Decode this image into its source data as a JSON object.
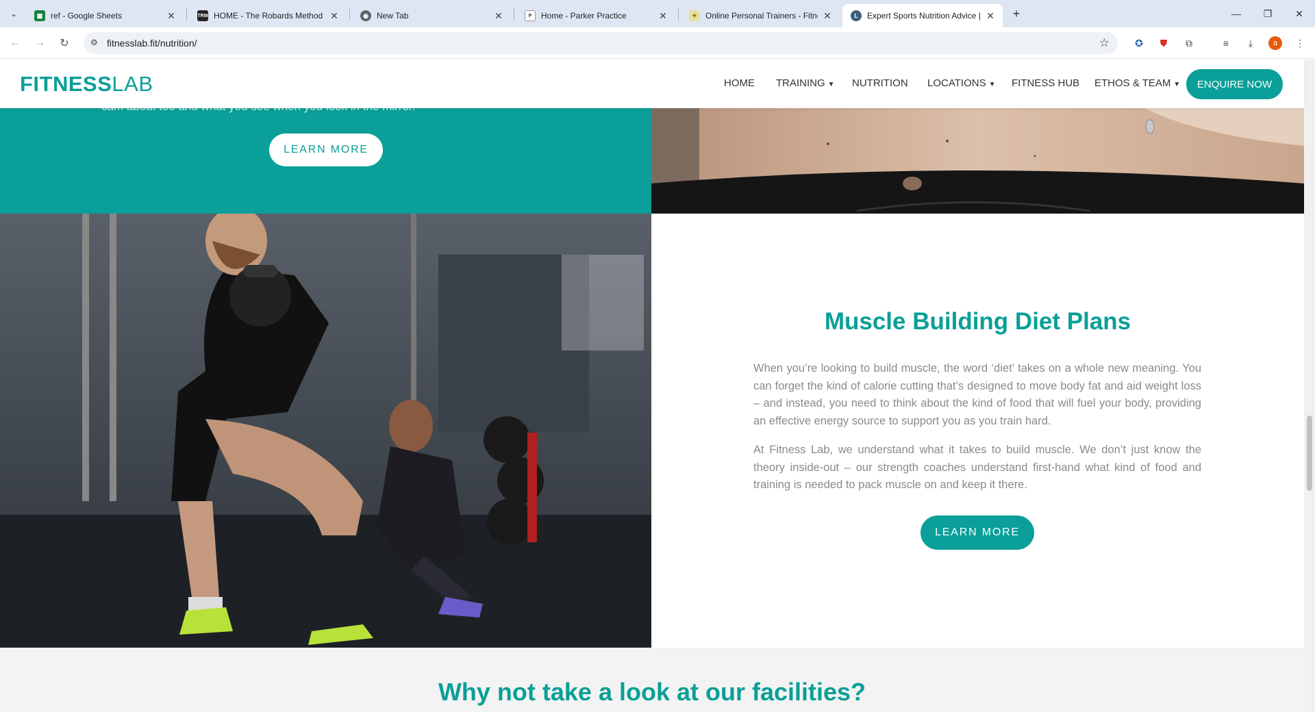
{
  "browser": {
    "tabs": [
      {
        "title": "ref - Google Sheets",
        "favicon": "sheets-icon",
        "color": "#188038"
      },
      {
        "title": "HOME - The Robards Method",
        "favicon": "trm-icon",
        "color": "#222222"
      },
      {
        "title": "New Tab",
        "favicon": "chrome-icon",
        "color": "#5f6368"
      },
      {
        "title": "Home - Parker Practice",
        "favicon": "pp-icon",
        "color": "#555555"
      },
      {
        "title": "Online Personal Trainers - Fitness",
        "favicon": "trainer-icon",
        "color": "#c9a227"
      },
      {
        "title": "Expert Sports Nutrition Advice | Fitness Lab",
        "favicon": "fitnesslab-icon",
        "color": "#3c5e7a"
      }
    ],
    "url": "fitnesslab.fit/nutrition/"
  },
  "site": {
    "logo_bold": "FITNESS",
    "logo_light": "LAB",
    "nav": [
      "HOME",
      "TRAINING",
      "NUTRITION",
      "LOCATIONS",
      "FITNESS HUB",
      "ETHOS & TEAM"
    ],
    "enquire": "ENQUIRE NOW"
  },
  "top_section": {
    "cut_text": "cam about too and what you see when you look in the mirror.",
    "button": "LEARN MORE"
  },
  "muscle_section": {
    "title": "Muscle Building Diet Plans",
    "paragraph1": "When you’re looking to build muscle, the word ‘diet’ takes on a whole new meaning. You can forget the kind of calorie cutting that’s designed to move body fat and aid weight loss – and instead, you need to think about the kind of food that will fuel your body, providing an effective energy source to support you as you train hard.",
    "paragraph2": "At Fitness Lab, we understand what it takes to build muscle. We don’t just know the theory inside-out – our strength coaches understand first-hand what kind of food and training is needed to pack muscle on and keep it there.",
    "button": "LEARN MORE"
  },
  "facilities": {
    "title": "Why not take a look at our facilities?"
  },
  "colors": {
    "brand_teal": "#0a9f98"
  }
}
